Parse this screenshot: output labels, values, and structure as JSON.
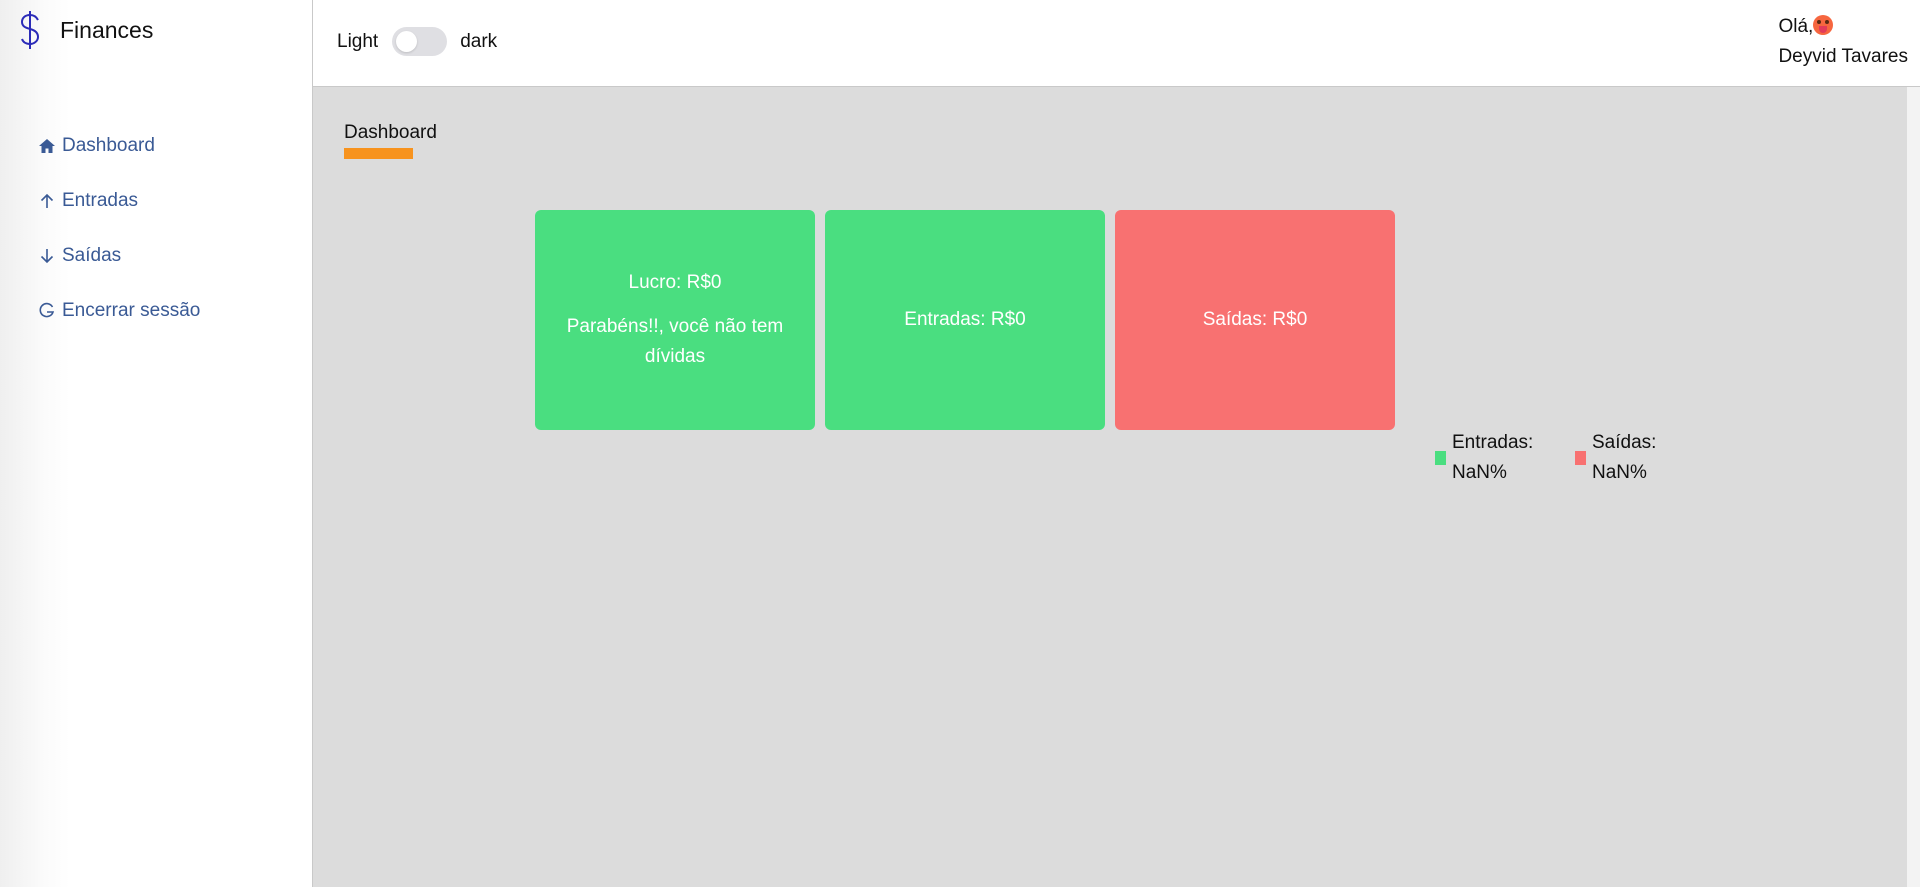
{
  "brand": {
    "name": "Finances",
    "icon": "dollar-icon",
    "color": "#2b2bb8"
  },
  "sidebar": {
    "items": [
      {
        "label": "Dashboard",
        "icon": "home-icon"
      },
      {
        "label": "Entradas",
        "icon": "arrow-up-icon"
      },
      {
        "label": "Saídas",
        "icon": "arrow-down-icon"
      },
      {
        "label": "Encerrar sessão",
        "icon": "logout-icon"
      }
    ]
  },
  "header": {
    "theme_light": "Light",
    "theme_dark": "dark",
    "greeting": "Olá,",
    "user_name": "Deyvid Tavares"
  },
  "main": {
    "title": "Dashboard",
    "cards": [
      {
        "title": "Lucro: R$0",
        "subtitle": "Parabéns!!, você não tem dívidas",
        "color": "#4ade80"
      },
      {
        "title": "Entradas: R$0",
        "color": "#4ade80"
      },
      {
        "title": "Saídas: R$0",
        "color": "#f87171"
      }
    ],
    "legend": [
      {
        "label": "Entradas:",
        "value": "NaN%",
        "color": "#4ade80"
      },
      {
        "label": "Saídas:",
        "value": "NaN%",
        "color": "#f87171"
      }
    ]
  },
  "colors": {
    "accent": "#f7931e",
    "link": "#3a5a95"
  }
}
